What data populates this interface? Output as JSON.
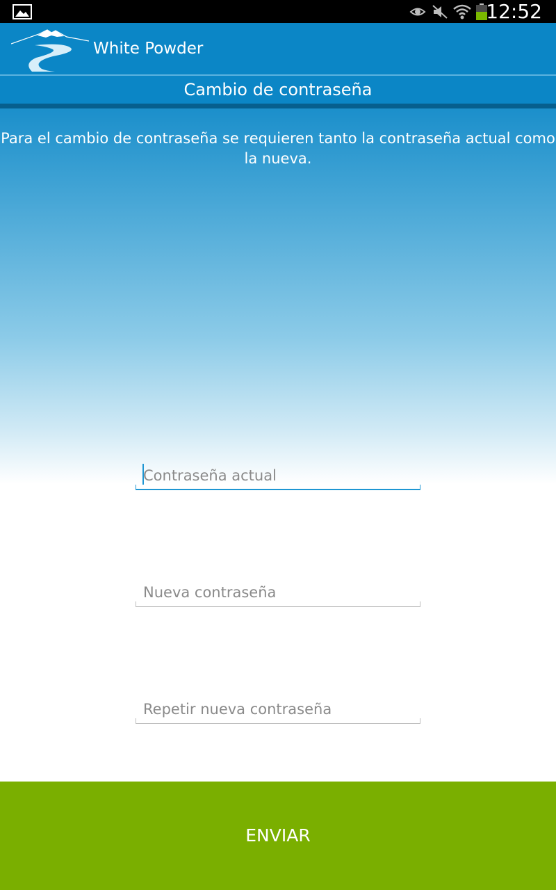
{
  "status_bar": {
    "time": "12:52",
    "icons": [
      "gallery-notification-icon",
      "eye-icon",
      "mute-icon",
      "wifi-icon",
      "battery-icon"
    ],
    "battery_color": "#7ab800"
  },
  "app": {
    "title": "White Powder",
    "logo": "mountain-logo"
  },
  "section": {
    "title": "Cambio de contraseña"
  },
  "form": {
    "instructions": "Para el cambio de contraseña se requieren tanto la contraseña actual como la nueva.",
    "current_password": {
      "placeholder": "Contraseña actual",
      "value": ""
    },
    "new_password": {
      "placeholder": "Nueva contraseña",
      "value": ""
    },
    "repeat_password": {
      "placeholder": "Repetir nueva contraseña",
      "value": ""
    },
    "submit_label": "ENVIAR"
  },
  "colors": {
    "action_bar": "#0b86c6",
    "accent_line": "#065f8e",
    "submit": "#7aaf00",
    "focus": "#1e96d3"
  }
}
